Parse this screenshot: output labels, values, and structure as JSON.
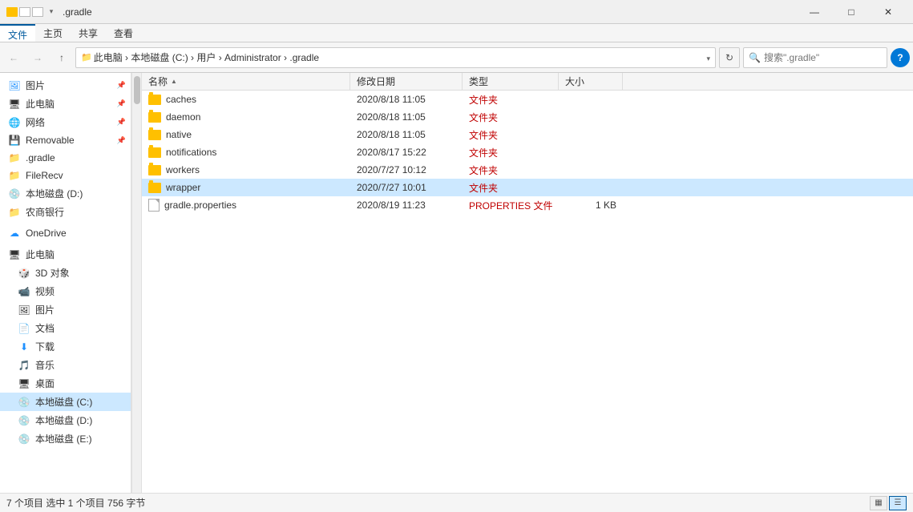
{
  "titlebar": {
    "icon_label": "📁",
    "title": ".gradle",
    "min_label": "—",
    "max_label": "□",
    "close_label": "✕",
    "dropdown_label": "▾"
  },
  "ribbon": {
    "tabs": [
      "文件",
      "主页",
      "共享",
      "查看"
    ]
  },
  "address": {
    "back_label": "←",
    "forward_label": "→",
    "up_label": "↑",
    "path_parts": [
      "此电脑",
      "本地磁盘 (C:)",
      "用户",
      "Administrator",
      ".gradle"
    ],
    "path_text": "此电脑 › 本地磁盘 (C:) › 用户 › Administrator › .gradle",
    "refresh_label": "↻",
    "search_placeholder": "搜索\".gradle\"",
    "help_label": "?"
  },
  "file_header": {
    "name_label": "名称",
    "date_label": "修改日期",
    "type_label": "类型",
    "size_label": "大小",
    "sort_arrow": "▲"
  },
  "files": [
    {
      "name": "caches",
      "date": "2020/8/18 11:05",
      "type": "文件夹",
      "size": "",
      "kind": "folder",
      "selected": false
    },
    {
      "name": "daemon",
      "date": "2020/8/18 11:05",
      "type": "文件夹",
      "size": "",
      "kind": "folder",
      "selected": false
    },
    {
      "name": "native",
      "date": "2020/8/18 11:05",
      "type": "文件夹",
      "size": "",
      "kind": "folder",
      "selected": false
    },
    {
      "name": "notifications",
      "date": "2020/8/17 15:22",
      "type": "文件夹",
      "size": "",
      "kind": "folder",
      "selected": false
    },
    {
      "name": "workers",
      "date": "2020/7/27 10:12",
      "type": "文件夹",
      "size": "",
      "kind": "folder",
      "selected": false
    },
    {
      "name": "wrapper",
      "date": "2020/7/27 10:01",
      "type": "文件夹",
      "size": "",
      "kind": "folder",
      "selected": true
    },
    {
      "name": "gradle.properties",
      "date": "2020/8/19 11:23",
      "type": "PROPERTIES 文件",
      "size": "1 KB",
      "kind": "file",
      "selected": false
    }
  ],
  "sidebar": {
    "items": [
      {
        "label": "图片",
        "icon": "pic",
        "pinned": true,
        "indent": 0
      },
      {
        "label": "此电脑",
        "icon": "pc",
        "pinned": true,
        "indent": 0
      },
      {
        "label": "网络",
        "icon": "net",
        "pinned": true,
        "indent": 0
      },
      {
        "label": "Removable",
        "icon": "drive",
        "pinned": true,
        "indent": 0
      },
      {
        "label": ".gradle",
        "icon": "folder",
        "pinned": false,
        "indent": 0
      },
      {
        "label": "FileRecv",
        "icon": "folder",
        "pinned": false,
        "indent": 0
      },
      {
        "label": "本地磁盘 (D:)",
        "icon": "drive",
        "pinned": false,
        "indent": 0
      },
      {
        "label": "农商银行",
        "icon": "folder",
        "pinned": false,
        "indent": 0
      },
      {
        "label": "OneDrive",
        "icon": "onedrive",
        "pinned": false,
        "indent": 0
      },
      {
        "label": "此电脑",
        "icon": "pc",
        "pinned": false,
        "indent": 0
      },
      {
        "label": "3D 对象",
        "icon": "3d",
        "pinned": false,
        "indent": 1
      },
      {
        "label": "视频",
        "icon": "video",
        "pinned": false,
        "indent": 1
      },
      {
        "label": "图片",
        "icon": "pic",
        "pinned": false,
        "indent": 1
      },
      {
        "label": "文档",
        "icon": "doc",
        "pinned": false,
        "indent": 1
      },
      {
        "label": "下载",
        "icon": "download",
        "pinned": false,
        "indent": 1
      },
      {
        "label": "音乐",
        "icon": "music",
        "pinned": false,
        "indent": 1
      },
      {
        "label": "桌面",
        "icon": "desktop",
        "pinned": false,
        "indent": 1
      },
      {
        "label": "本地磁盘 (C:)",
        "icon": "drive",
        "pinned": false,
        "indent": 1,
        "active": true
      },
      {
        "label": "本地磁盘 (D:)",
        "icon": "drive",
        "pinned": false,
        "indent": 1
      },
      {
        "label": "本地磁盘 (E:)",
        "icon": "drive",
        "pinned": false,
        "indent": 1
      }
    ]
  },
  "statusbar": {
    "text": "7 个项目  选中 1 个项目  756 字节",
    "view1_label": "▦",
    "view2_label": "☰"
  }
}
